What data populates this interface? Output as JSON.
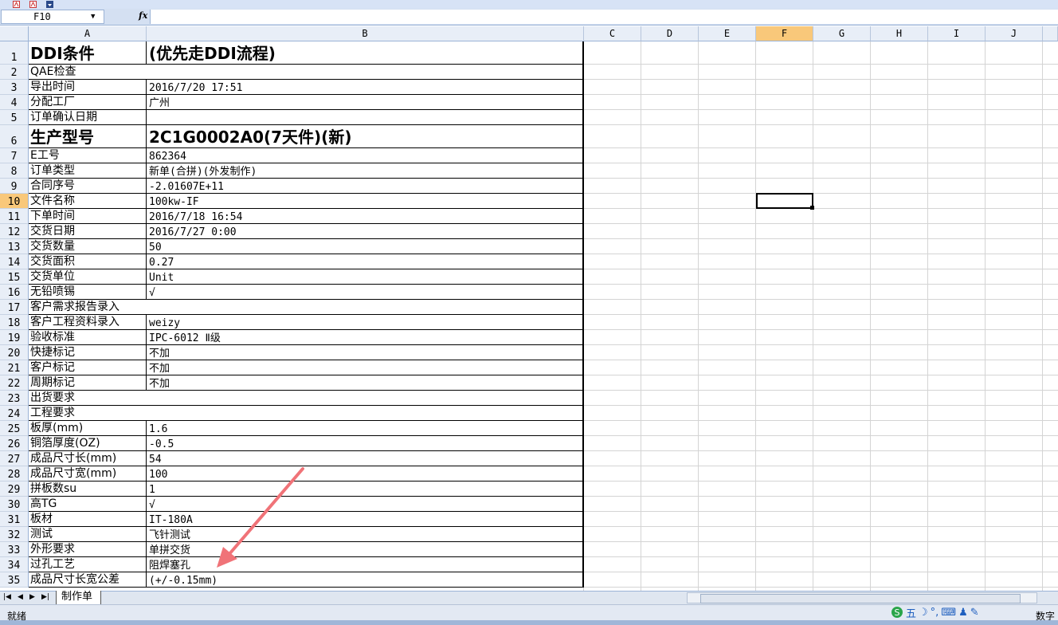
{
  "formula_bar": {
    "name_box": "F10",
    "fx_label": "fx",
    "formula": ""
  },
  "columns": [
    "A",
    "B",
    "C",
    "D",
    "E",
    "F",
    "G",
    "H",
    "I",
    "J"
  ],
  "selected_column": "F",
  "selected_row": "10",
  "rows": [
    {
      "n": "1",
      "a": "DDI条件",
      "b": "(优先走DDI流程)"
    },
    {
      "n": "2",
      "a": "QAE检查",
      "b": ""
    },
    {
      "n": "3",
      "a": "导出时间",
      "b": "2016/7/20 17:51"
    },
    {
      "n": "4",
      "a": "分配工厂",
      "b": "广州"
    },
    {
      "n": "5",
      "a": "订单确认日期",
      "b": ""
    },
    {
      "n": "6",
      "a": "生产型号",
      "b": "2C1G0002A0(7天件)(新)"
    },
    {
      "n": "7",
      "a": "E工号",
      "b": "862364"
    },
    {
      "n": "8",
      "a": "订单类型",
      "b": "新单(合拼)(外发制作)"
    },
    {
      "n": "9",
      "a": "合同序号",
      "b": "-2.01607E+11"
    },
    {
      "n": "10",
      "a": "文件名称",
      "b": "100kw-IF"
    },
    {
      "n": "11",
      "a": "下单时间",
      "b": "2016/7/18 16:54"
    },
    {
      "n": "12",
      "a": "交货日期",
      "b": "2016/7/27 0:00"
    },
    {
      "n": "13",
      "a": "交货数量",
      "b": "50"
    },
    {
      "n": "14",
      "a": "交货面积",
      "b": "0.27"
    },
    {
      "n": "15",
      "a": "交货单位",
      "b": "Unit"
    },
    {
      "n": "16",
      "a": "无铅喷锡",
      "b": "√"
    },
    {
      "n": "17",
      "a": "客户需求报告录入",
      "b": ""
    },
    {
      "n": "18",
      "a": "客户工程资料录入",
      "b": "weizy"
    },
    {
      "n": "19",
      "a": "验收标准",
      "b": "IPC-6012 Ⅱ级"
    },
    {
      "n": "20",
      "a": "快捷标记",
      "b": "不加"
    },
    {
      "n": "21",
      "a": "客户标记",
      "b": "不加"
    },
    {
      "n": "22",
      "a": "周期标记",
      "b": "不加"
    },
    {
      "n": "23",
      "a": "出货要求",
      "b": ""
    },
    {
      "n": "24",
      "a": "工程要求",
      "b": ""
    },
    {
      "n": "25",
      "a": "板厚(mm)",
      "b": "1.6"
    },
    {
      "n": "26",
      "a": "铜箔厚度(OZ)",
      "b": "-0.5"
    },
    {
      "n": "27",
      "a": "成品尺寸长(mm)",
      "b": "54"
    },
    {
      "n": "28",
      "a": "成品尺寸宽(mm)",
      "b": "100"
    },
    {
      "n": "29",
      "a": "拼板数su",
      "b": "1"
    },
    {
      "n": "30",
      "a": "高TG",
      "b": "√"
    },
    {
      "n": "31",
      "a": "板材",
      "b": "IT-180A"
    },
    {
      "n": "32",
      "a": "测试",
      "b": "飞针测试"
    },
    {
      "n": "33",
      "a": "外形要求",
      "b": "单拼交货"
    },
    {
      "n": "34",
      "a": "过孔工艺",
      "b": "阻焊塞孔"
    },
    {
      "n": "35",
      "a": "成品尺寸长宽公差",
      "b": "(+/-0.15mm)"
    }
  ],
  "sheet_tab": "制作单",
  "status": {
    "ready": "就绪",
    "mode": "数字",
    "ime": "五"
  }
}
